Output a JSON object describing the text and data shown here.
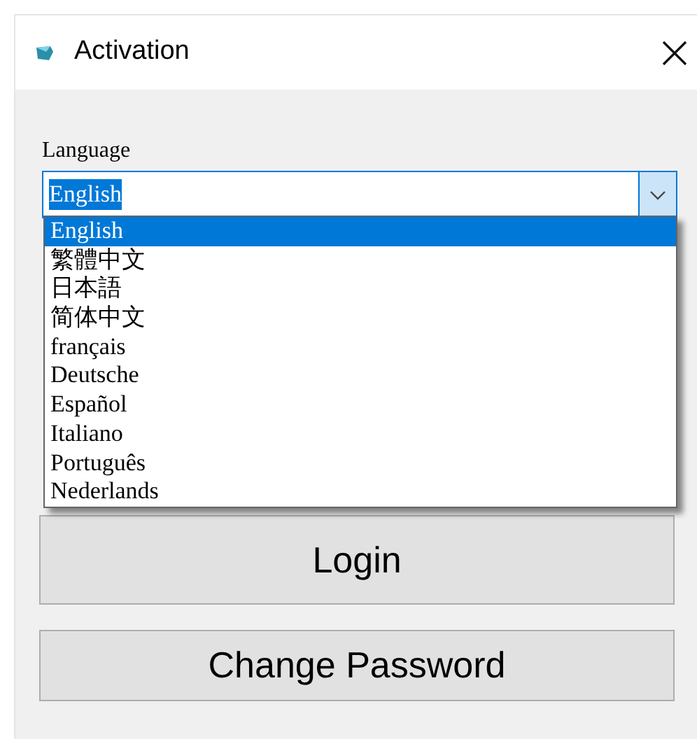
{
  "window": {
    "title": "Activation"
  },
  "language": {
    "label": "Language",
    "value": "English",
    "value_highlighted": true,
    "expanded": true,
    "options": [
      {
        "label": "English",
        "selected": true
      },
      {
        "label": "繁體中文",
        "selected": false
      },
      {
        "label": "日本語",
        "selected": false
      },
      {
        "label": "简体中文",
        "selected": false
      },
      {
        "label": "français",
        "selected": false
      },
      {
        "label": "Deutsche",
        "selected": false
      },
      {
        "label": "Español",
        "selected": false
      },
      {
        "label": "Italiano",
        "selected": false
      },
      {
        "label": "Português",
        "selected": false
      },
      {
        "label": "Nederlands",
        "selected": false
      }
    ]
  },
  "buttons": [
    "Login",
    "Change Password"
  ]
}
